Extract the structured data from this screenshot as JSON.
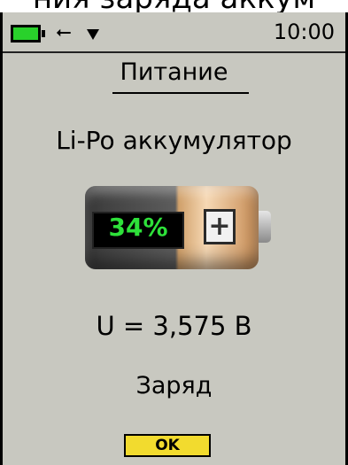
{
  "caption_text": "ния заряда аккум",
  "status_bar": {
    "time": "10:00",
    "icons": [
      "battery-icon",
      "usb-icon",
      "arrow-down-icon"
    ],
    "battery_icon_color": "#29d12b"
  },
  "screen": {
    "title": "Питание",
    "battery_type": "Li-Po аккумулятор",
    "battery_percent": "34%",
    "battery_level": 0.34,
    "voltage": "U = 3,575 В",
    "charge_status": "Заряд",
    "ok_label": "OK"
  },
  "colors": {
    "screen_background": "#c8c8c0",
    "percent_text": "#2ee13a",
    "ok_button": "#f2db2e"
  }
}
